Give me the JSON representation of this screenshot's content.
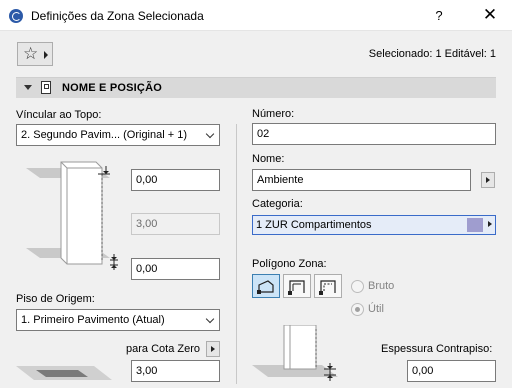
{
  "window": {
    "title": "Definições da Zona Selecionada",
    "help_label": "?",
    "close_label": "✕"
  },
  "toolbar": {
    "favorites_icon": "star-icon",
    "selection_status": "Selecionado: 1 Editável: 1"
  },
  "section": {
    "title": "NOME E POSIÇÃO",
    "icon": "zone-doc-icon"
  },
  "left": {
    "top_link_label": "Víncular ao Topo:",
    "top_link_value": "2. Segundo Pavim... (Original + 1)",
    "top_offset_value": "0,00",
    "height_value": "3,00",
    "bottom_offset_value": "0,00",
    "home_story_label": "Piso de Origem:",
    "home_story_value": "1. Primeiro Pavimento (Atual)",
    "ref_level_label": "para Cota Zero",
    "ref_level_value": "3,00"
  },
  "right": {
    "number_label": "Número:",
    "number_value": "02",
    "name_label": "Nome:",
    "name_value": "Ambiente",
    "category_label": "Categoria:",
    "category_value": "1 ZUR  Compartimentos",
    "category_color": "#9f9dcf",
    "polygon_label": "Polígono Zona:",
    "radio_gross": "Bruto",
    "radio_net": "Útil",
    "floor_thickness_label": "Espessura Contrapiso:",
    "floor_thickness_value": "0,00"
  },
  "colors": {
    "accent": "#3a6bc9",
    "active_button": "#cce4f7",
    "header_band": "#d9d9d9"
  }
}
